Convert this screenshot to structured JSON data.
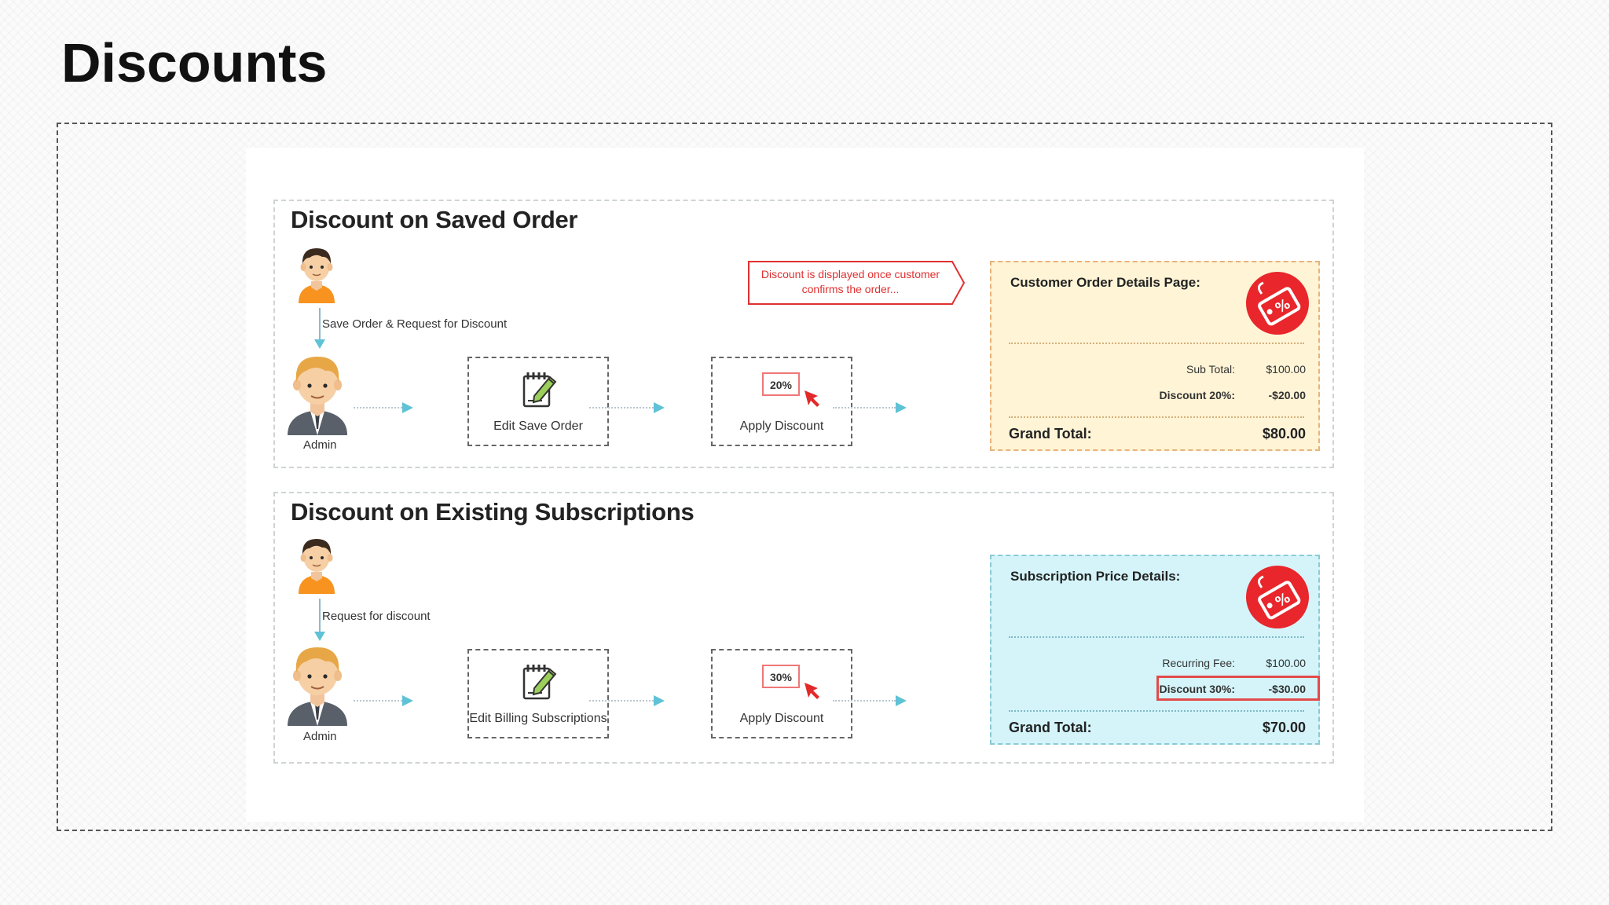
{
  "slide": {
    "title": "Discounts"
  },
  "sections": [
    {
      "title": "Discount on Saved Order",
      "request_label": "Save Order & Request for Discount",
      "admin_label": "Admin",
      "step1_label": "Edit Save Order",
      "step2_label": "Apply Discount",
      "percent_badge": "20%",
      "callout": "Discount is displayed once customer confirms the order...",
      "details": {
        "title": "Customer Order Details Page:",
        "rows": [
          {
            "label": "Sub Total:",
            "value": "$100.00"
          },
          {
            "label": "Discount 20%:",
            "value": "-$20.00"
          }
        ],
        "grand_label": "Grand Total:",
        "grand_value": "$80.00"
      }
    },
    {
      "title": "Discount on Existing Subscriptions",
      "request_label": "Request for discount",
      "admin_label": "Admin",
      "step1_label": "Edit Billing Subscriptions",
      "step2_label": "Apply Discount",
      "percent_badge": "30%",
      "details": {
        "title": "Subscription Price Details:",
        "rows": [
          {
            "label": "Recurring Fee:",
            "value": "$100.00"
          },
          {
            "label": "Discount 30%:",
            "value": "-$30.00"
          }
        ],
        "grand_label": "Grand Total:",
        "grand_value": "$70.00"
      }
    }
  ],
  "colors": {
    "accent_arrow": "#5fc2d6",
    "discount_red": "#e03030",
    "order_panel_bg": "#fff4d6",
    "subscription_panel_bg": "#d4f4fa"
  },
  "icons": [
    "customer-avatar-icon",
    "admin-avatar-icon",
    "notepad-pencil-icon",
    "cursor-click-icon",
    "discount-tag-icon"
  ]
}
